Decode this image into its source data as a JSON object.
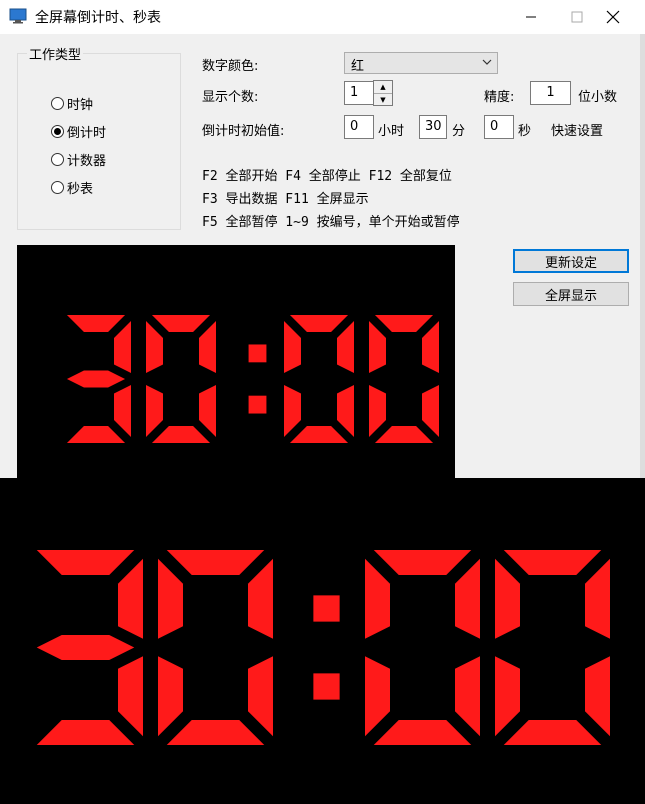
{
  "window": {
    "title": "全屏幕倒计时、秒表",
    "minimize_label": "—",
    "maximize_label": "☐",
    "close_label": "✕"
  },
  "work_type": {
    "title": "工作类型",
    "options": [
      {
        "label": "时钟",
        "selected": false
      },
      {
        "label": "倒计时",
        "selected": true
      },
      {
        "label": "计数器",
        "selected": false
      },
      {
        "label": "秒表",
        "selected": false
      }
    ]
  },
  "settings": {
    "color_label": "数字颜色:",
    "color_value": "红",
    "count_label": "显示个数:",
    "count_value": "1",
    "precision_label": "精度:",
    "precision_value": "1",
    "precision_unit": "位小数",
    "init_label": "倒计时初始值:",
    "hours_value": "0",
    "hours_unit": "小时",
    "minutes_value": "30",
    "minutes_unit": "分",
    "seconds_value": "0",
    "seconds_unit": "秒",
    "quick_set": "快速设置"
  },
  "hotkeys": [
    "F2 全部开始 F4 全部停止 F12 全部复位",
    "F3 导出数据 F11 全屏显示",
    "F5 全部暂停 1~9 按编号，单个开始或暂停"
  ],
  "buttons": {
    "update": "更新设定",
    "fullscreen": "全屏显示"
  },
  "display": {
    "time": "30:00",
    "digit_color": "#ff1a1a"
  }
}
